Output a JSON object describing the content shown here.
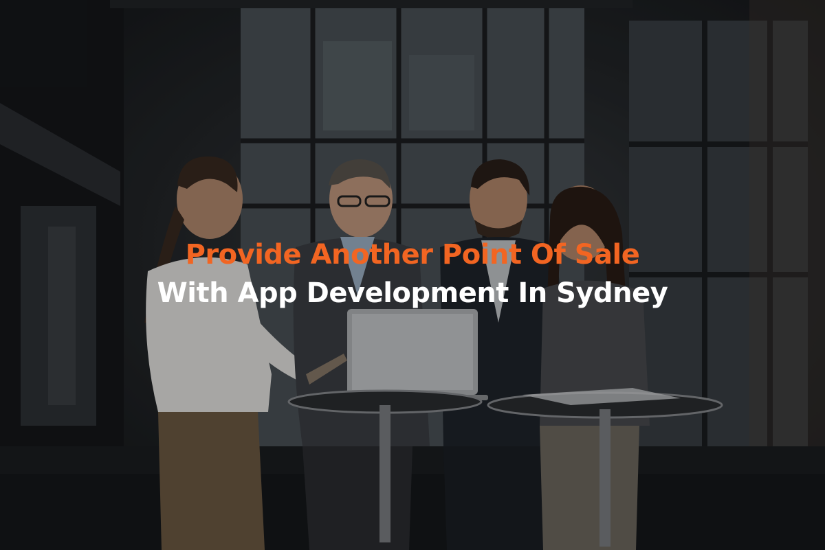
{
  "hero": {
    "headline_line1": "Provide Another Point Of Sale",
    "headline_line2": "With App Development In Sydney"
  },
  "colors": {
    "accent": "#f26522",
    "headline_white": "#ffffff",
    "background_dark": "#1a1c1f"
  },
  "image": {
    "description_icon": "business-meeting-photo"
  }
}
